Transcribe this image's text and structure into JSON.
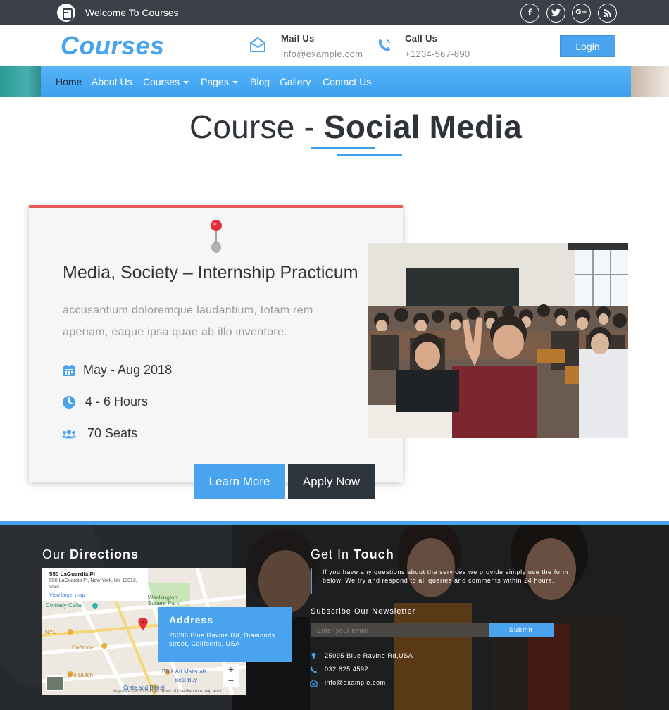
{
  "topbar": {
    "welcome": "Welcome To Courses",
    "social": [
      {
        "icon": "facebook-icon",
        "glyph": "f"
      },
      {
        "icon": "twitter-icon",
        "glyph": "t"
      },
      {
        "icon": "google-plus-icon",
        "glyph": "G+"
      },
      {
        "icon": "rss-icon",
        "glyph": "rss"
      }
    ]
  },
  "header": {
    "brand": "Courses",
    "mail_title": "Mail Us",
    "mail_value": "info@example.com",
    "call_title": "Call Us",
    "call_value": "+1234-567-890",
    "login_label": "Login"
  },
  "nav": {
    "items": [
      "Home",
      "About Us",
      "Courses",
      "Pages",
      "Blog",
      "Gallery",
      "Contact Us"
    ]
  },
  "page": {
    "title_prefix": "Course - ",
    "title_bold": "Social Media"
  },
  "course": {
    "title": "Media, Society – Internship Practicum",
    "description": "accusantium doloremque laudantium, totam rem aperiam, eaque ipsa quae ab illo inventore.",
    "date": "May - Aug 2018",
    "hours": "4 - 6 Hours",
    "seats": "70 Seats",
    "learn_more": "Learn More",
    "apply_now": "Apply Now"
  },
  "footer": {
    "directions_prefix": "Our ",
    "directions_bold": "Directions",
    "touch_prefix": "Get In ",
    "touch_bold": "Touch",
    "touch_text": "If you have any questions about the services we provide simply use the form below. We try and respond to all queries and comments within 24 hours.",
    "newsletter_title": "Subscribe Our Newsletter",
    "email_placeholder": "Enter your email",
    "submit_label": "Submit",
    "address_line": "25095 Blue Ravine Rd,USA",
    "phone": "032 625 4592",
    "email": "info@example.com",
    "address_box_title": "Address",
    "address_box_value": "25095 Blue Ravine Rd, Diamonds street, California, USA",
    "map": {
      "place": "550 LaGuardia Pl",
      "place_address": "550 LaGuardia Pl, New York, NY 10012, USA",
      "larger_map": "View larger map",
      "labels": [
        "Comedy Cellar",
        "Washington Square Park",
        "Carbone",
        "The Dutch",
        "Blick Art Materials",
        "Best Buy",
        "Crate and Barrel",
        "NYC"
      ],
      "attribution": "Map data ©2020 Google   Terms of Use   Report a map error"
    }
  },
  "colors": {
    "accent": "#4aa3ef",
    "dark": "#2f353d",
    "card_top": "#e55b5a"
  }
}
